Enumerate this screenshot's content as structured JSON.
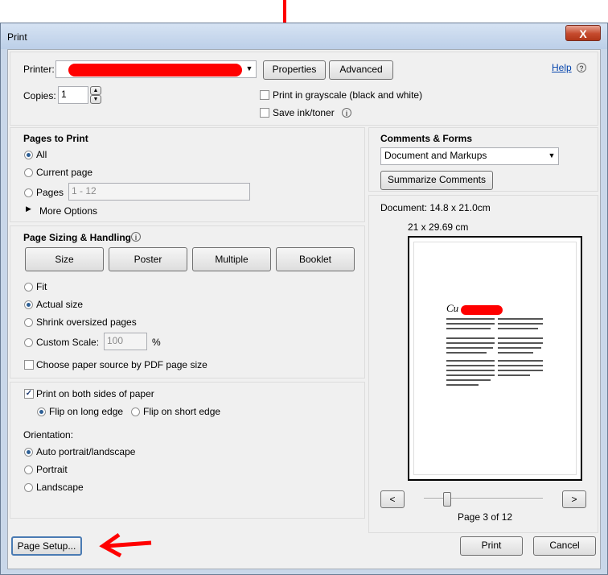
{
  "window": {
    "title": "Print",
    "close_label": "X"
  },
  "printer": {
    "label": "Printer:",
    "properties_label": "Properties",
    "advanced_label": "Advanced",
    "help_label": "Help"
  },
  "copies": {
    "label": "Copies:",
    "value": "1"
  },
  "options": {
    "grayscale_label": "Print in grayscale (black and white)",
    "save_ink_label": "Save ink/toner"
  },
  "pages_to_print": {
    "heading": "Pages to Print",
    "all_label": "All",
    "current_label": "Current page",
    "pages_label": "Pages",
    "pages_placeholder": "1 - 12",
    "more_options_label": "More Options"
  },
  "sizing": {
    "heading": "Page Sizing & Handling",
    "tabs": {
      "size": "Size",
      "poster": "Poster",
      "multiple": "Multiple",
      "booklet": "Booklet"
    },
    "fit_label": "Fit",
    "actual_label": "Actual size",
    "shrink_label": "Shrink oversized pages",
    "custom_label": "Custom Scale:",
    "custom_value": "100",
    "percent": "%",
    "paper_source_label": "Choose paper source by PDF page size"
  },
  "duplex": {
    "both_sides_label": "Print on both sides of paper",
    "long_edge_label": "Flip on long edge",
    "short_edge_label": "Flip on short edge"
  },
  "orientation": {
    "heading": "Orientation:",
    "auto_label": "Auto portrait/landscape",
    "portrait_label": "Portrait",
    "landscape_label": "Landscape"
  },
  "comments": {
    "heading": "Comments & Forms",
    "selected": "Document and Markups",
    "summarize_label": "Summarize Comments"
  },
  "preview": {
    "document_size": "Document: 14.8 x 21.0cm",
    "paper_size": "21 x 29.69 cm",
    "page_indicator": "Page 3 of 12",
    "prev_label": "<",
    "next_label": ">"
  },
  "footer": {
    "page_setup_label": "Page Setup...",
    "print_label": "Print",
    "cancel_label": "Cancel"
  },
  "colors": {
    "accent": "#2d5f95",
    "annotation": "#ff0000"
  }
}
